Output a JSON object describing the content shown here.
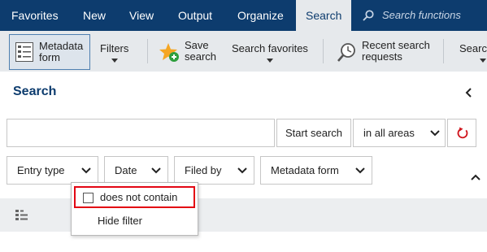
{
  "nav": {
    "tabs": [
      "Favorites",
      "New",
      "View",
      "Output",
      "Organize",
      "Search"
    ],
    "active_tab": "Search",
    "search_placeholder": "Search functions"
  },
  "ribbon": {
    "metadata_form": "Metadata form",
    "filters": "Filters",
    "save_search": "Save search",
    "search_favorites": "Search favorites",
    "recent_search_requests": "Recent search requests",
    "search_truncated": "Searc"
  },
  "panel": {
    "title": "Search",
    "search_value": "",
    "start_search": "Start search",
    "area_selected": "in all areas"
  },
  "filters": [
    "Entry type",
    "Date",
    "Filed by",
    "Metadata form"
  ],
  "dropdown": {
    "does_not_contain": "does not contain",
    "does_not_contain_checked": false,
    "hide_filter": "Hide filter"
  },
  "colors": {
    "nav_bg": "#0d3c6e",
    "ribbon_bg": "#e6e9ec",
    "accent_red": "#e30613",
    "title_blue": "#0d3c6e"
  }
}
